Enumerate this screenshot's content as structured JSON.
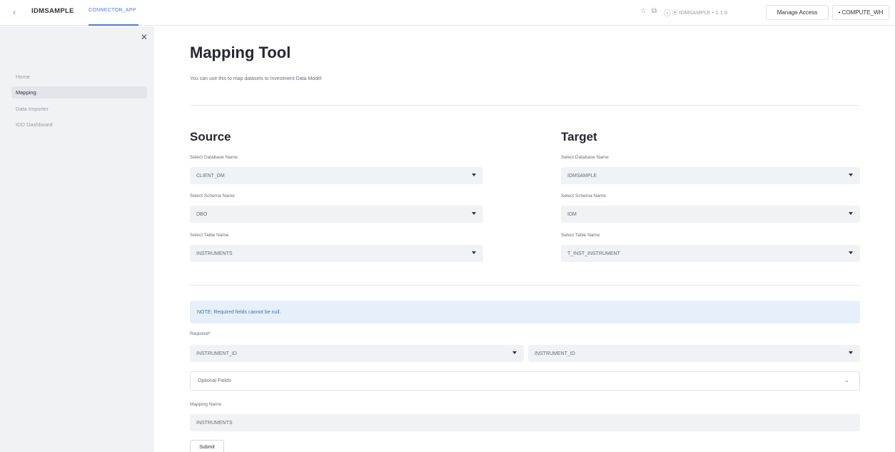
{
  "topbar": {
    "back_icon": "chevron-left-icon",
    "app_name": "IDMSAMPLE",
    "tab_label": "CONNECTOR_APP",
    "icons": [
      "star-icon",
      "copy-icon",
      "info-icon"
    ],
    "context": "⦿ IDMSAMPLE • 1.1.6",
    "manage_access": "Manage Access",
    "warehouse": "• COMPUTE_WH"
  },
  "sidebar": {
    "close_icon": "✕",
    "items": [
      {
        "label": "Home"
      },
      {
        "label": "Mapping"
      },
      {
        "label": "Data Importer"
      },
      {
        "label": "IDD Dashboard"
      }
    ]
  },
  "main": {
    "title": "Mapping Tool",
    "subtitle": "You can use this to map datasets to Investment Data Model",
    "source": {
      "heading": "Source",
      "database_label": "Select Database Name",
      "database_value": "CLIENT_DM",
      "schema_label": "Select Schema Name",
      "schema_value": "DBO",
      "table_label": "Select Table Name",
      "table_value": "INSTRUMENTS"
    },
    "target": {
      "heading": "Target",
      "database_label": "Select Database Name",
      "database_value": "IDMSAMPLE",
      "schema_label": "Select Schema Name",
      "schema_value": "IDM",
      "table_label": "Select Table Name",
      "table_value": "T_INST_INSTRUMENT"
    },
    "note": "NOTE: Required fields cannot be null.",
    "required_label": "Required*",
    "required_source_value": "INSTRUMENT_ID",
    "required_target_value": "INSTRUMENT_ID",
    "optional_fields_label": "Optional Fields",
    "mapping_name_label": "Mapping Name",
    "mapping_name_value": "INSTRUMENTS",
    "submit_label": "Submit"
  }
}
